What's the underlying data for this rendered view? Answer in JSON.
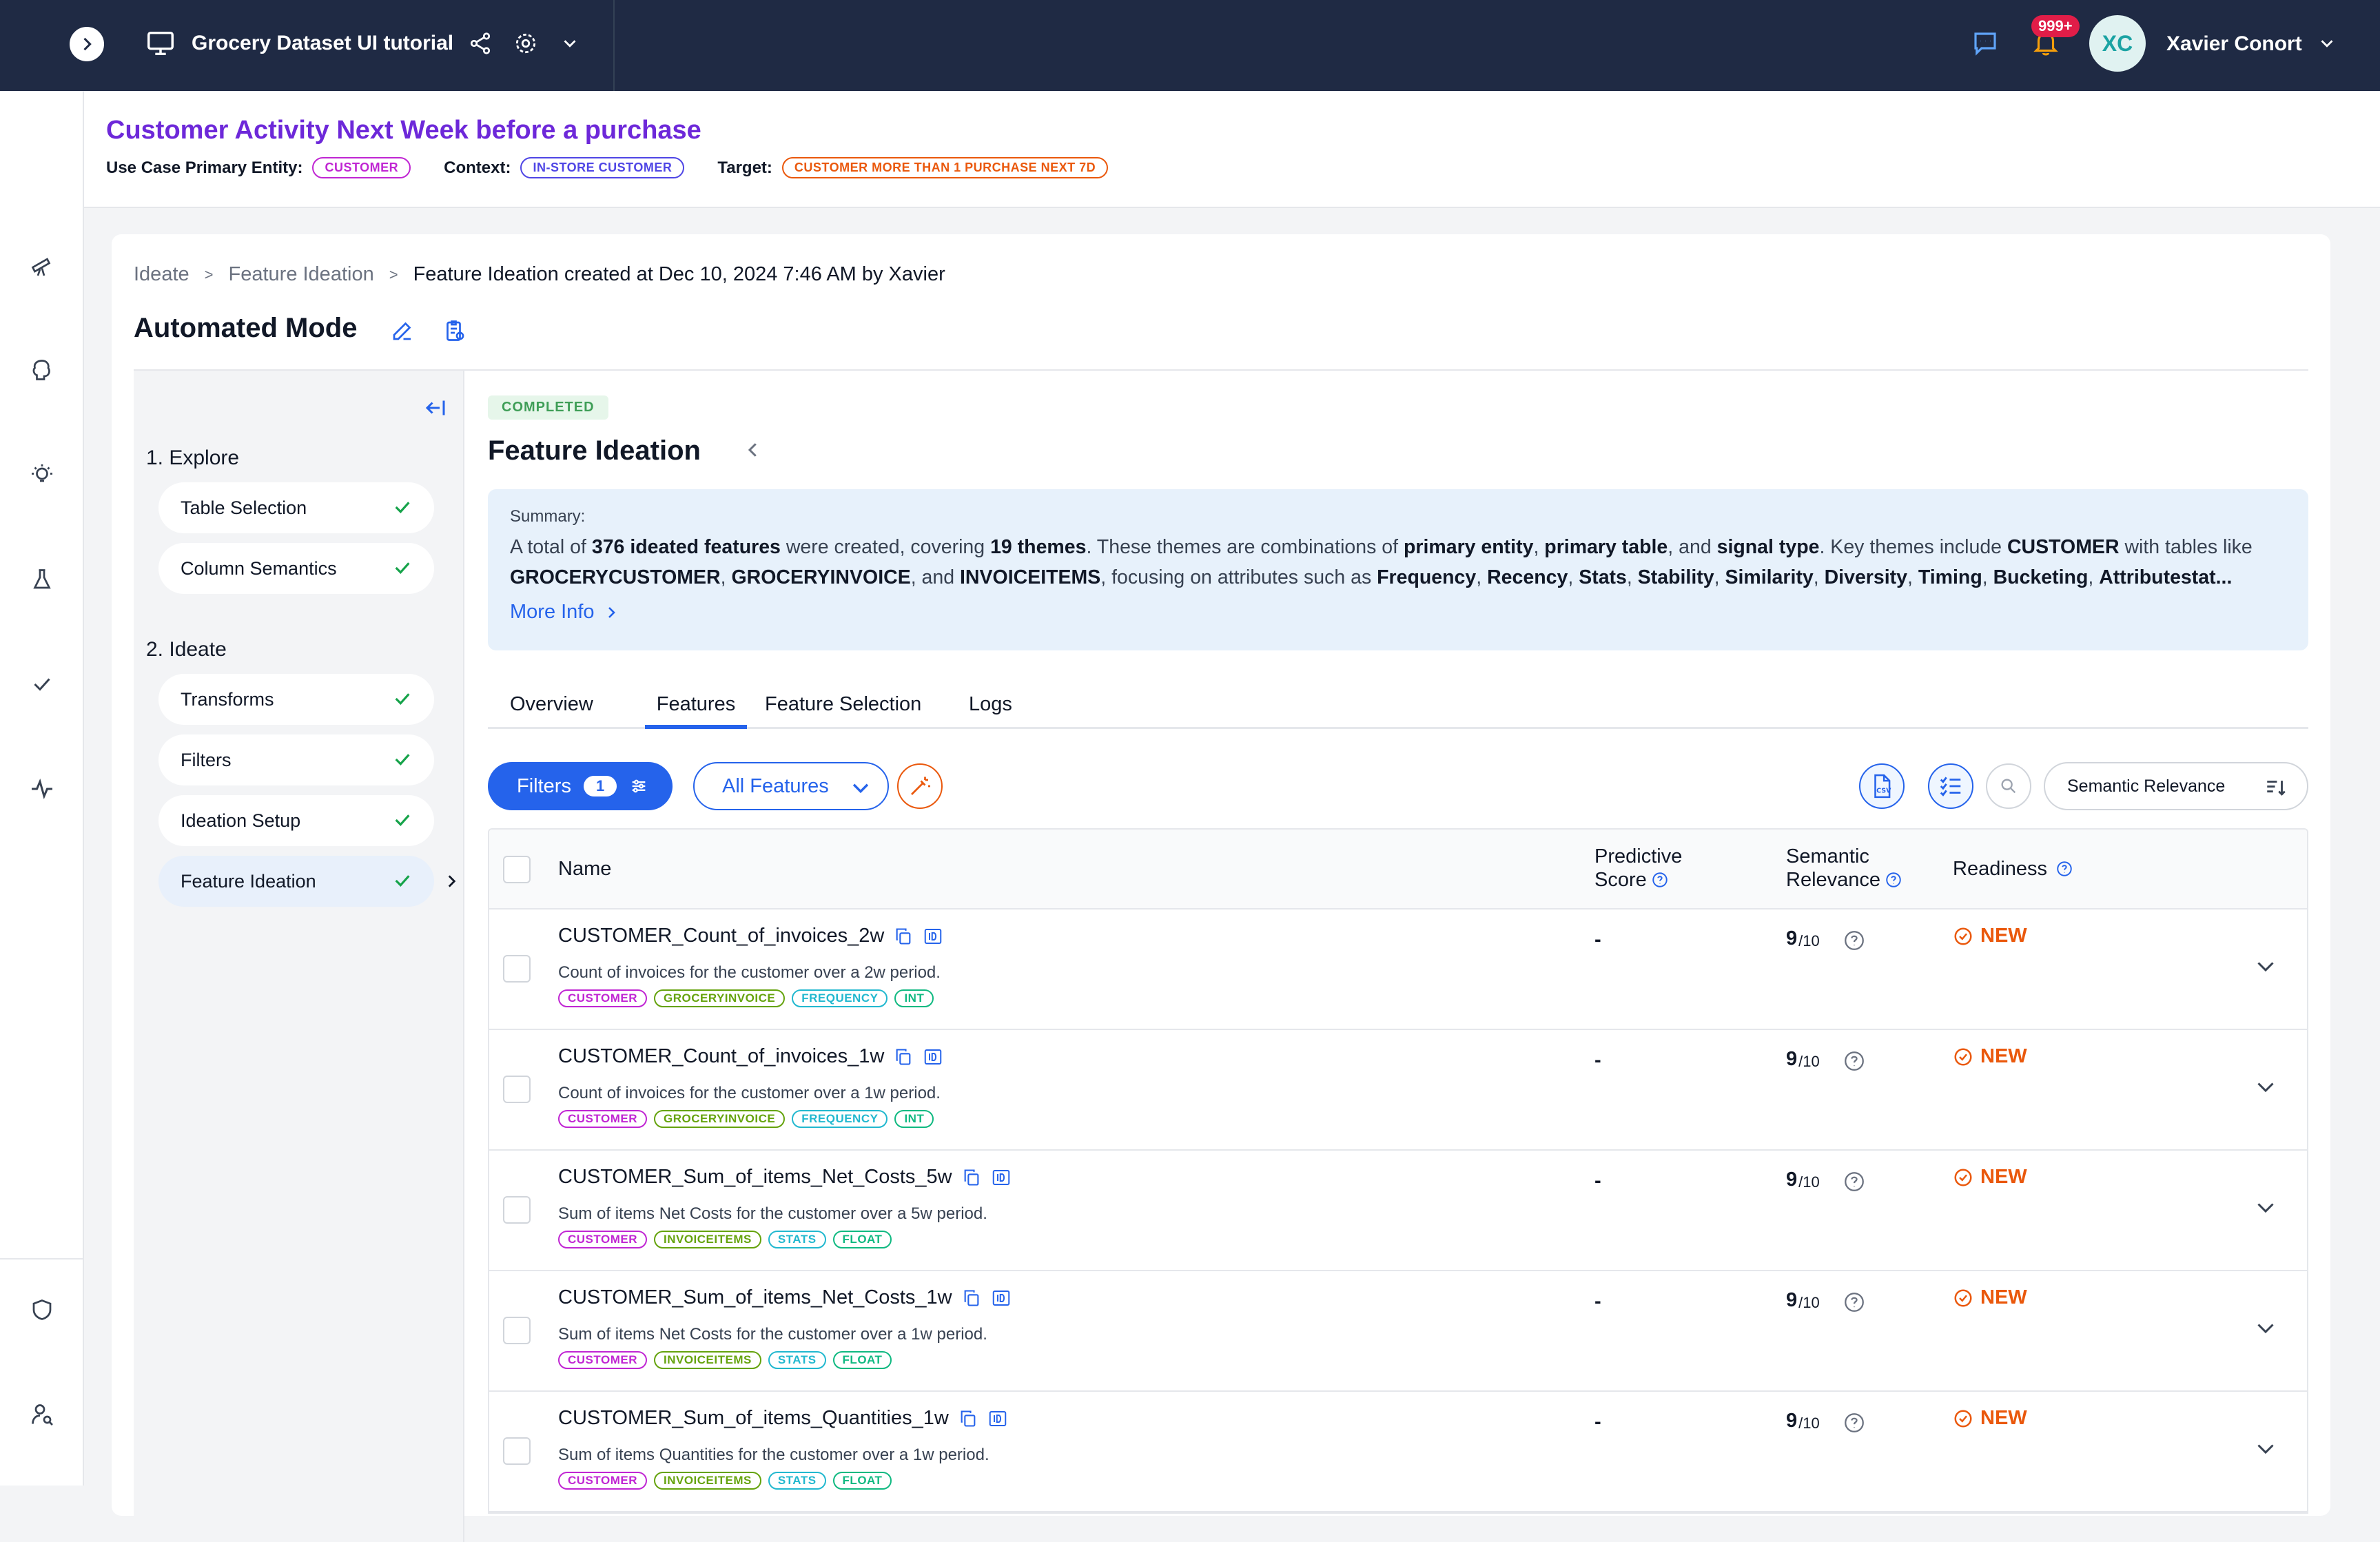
{
  "topbar": {
    "project_title": "Grocery Dataset UI tutorial",
    "notification_count": "999+",
    "avatar_initials": "XC",
    "user_name": "Xavier Conort"
  },
  "use_case": {
    "title": "Customer Activity Next Week before a purchase",
    "primary_entity_label": "Use Case Primary Entity:",
    "primary_entity_value": "CUSTOMER",
    "context_label": "Context:",
    "context_value": "IN-STORE CUSTOMER",
    "target_label": "Target:",
    "target_value": "CUSTOMER MORE THAN 1 PURCHASE NEXT 7D"
  },
  "breadcrumb": {
    "items": [
      "Ideate",
      "Feature Ideation",
      "Feature Ideation created at Dec 10, 2024 7:46 AM by Xavier"
    ]
  },
  "mode_title": "Automated Mode",
  "steps": {
    "explore_heading": "1. Explore",
    "explore_items": [
      "Table Selection",
      "Column Semantics"
    ],
    "ideate_heading": "2. Ideate",
    "ideate_items": [
      "Transforms",
      "Filters",
      "Ideation Setup",
      "Feature Ideation"
    ]
  },
  "status_badge": "COMPLETED",
  "panel_title": "Feature Ideation",
  "summary": {
    "label": "Summary:",
    "t1": "A total of ",
    "b1": "376 ideated features",
    "t2": " were created, covering ",
    "b2": "19 themes",
    "t3": ". These themes are combinations of ",
    "b3": "primary entity",
    "t4": ", ",
    "b4": "primary table",
    "t5": ", and ",
    "b5": "signal type",
    "t6": ". Key themes include ",
    "b6": "CUSTOMER",
    "t7": " with tables like ",
    "b7": "GROCERYCUSTOMER",
    "t8": ", ",
    "b8": "GROCERYINVOICE",
    "t9": ", and ",
    "b9": "INVOICEITEMS",
    "t10": ", focusing on attributes such as ",
    "b10": "Frequency",
    "t11": ", ",
    "b11": "Recency",
    "t12": ", ",
    "b12": "Stats",
    "t13": ", ",
    "b13": "Stability",
    "t14": ", ",
    "b14": "Similarity",
    "t15": ", ",
    "b15": "Diversity",
    "t16": ", ",
    "b16": "Timing",
    "t17": ", ",
    "b17": "Bucketing",
    "t18": ", ",
    "b18": "Attributestat...",
    "more_info": "More Info"
  },
  "tabs": [
    "Overview",
    "Features",
    "Feature Selection",
    "Logs"
  ],
  "toolbar": {
    "filters_label": "Filters",
    "filters_count": "1",
    "all_features_label": "All Features",
    "sort_label": "Semantic Relevance"
  },
  "table": {
    "headers": {
      "name": "Name",
      "predictive_1": "Predictive",
      "predictive_2": "Score",
      "semantic_1": "Semantic",
      "semantic_2": "Relevance",
      "readiness": "Readiness"
    },
    "rows": [
      {
        "name": "CUSTOMER_Count_of_invoices_2w",
        "desc": "Count of invoices for the customer over a 2w period.",
        "tags": [
          "CUSTOMER",
          "GROCERYINVOICE",
          "FREQUENCY",
          "INT"
        ],
        "pscore": "-",
        "srel": "9",
        "srel_den": "/10",
        "readiness": "NEW"
      },
      {
        "name": "CUSTOMER_Count_of_invoices_1w",
        "desc": "Count of invoices for the customer over a 1w period.",
        "tags": [
          "CUSTOMER",
          "GROCERYINVOICE",
          "FREQUENCY",
          "INT"
        ],
        "pscore": "-",
        "srel": "9",
        "srel_den": "/10",
        "readiness": "NEW"
      },
      {
        "name": "CUSTOMER_Sum_of_items_Net_Costs_5w",
        "desc": "Sum of items Net Costs for the customer over a 5w period.",
        "tags": [
          "CUSTOMER",
          "INVOICEITEMS",
          "STATS",
          "FLOAT"
        ],
        "pscore": "-",
        "srel": "9",
        "srel_den": "/10",
        "readiness": "NEW"
      },
      {
        "name": "CUSTOMER_Sum_of_items_Net_Costs_1w",
        "desc": "Sum of items Net Costs for the customer over a 1w period.",
        "tags": [
          "CUSTOMER",
          "INVOICEITEMS",
          "STATS",
          "FLOAT"
        ],
        "pscore": "-",
        "srel": "9",
        "srel_den": "/10",
        "readiness": "NEW"
      },
      {
        "name": "CUSTOMER_Sum_of_items_Quantities_1w",
        "desc": "Sum of items Quantities for the customer over a 1w period.",
        "tags": [
          "CUSTOMER",
          "INVOICEITEMS",
          "STATS",
          "FLOAT"
        ],
        "pscore": "-",
        "srel": "9",
        "srel_den": "/10",
        "readiness": "NEW"
      }
    ]
  },
  "colors": {
    "topbar": "#1f2a44",
    "accent": "#2563eb",
    "use_case_title": "#6d28d9",
    "entity_tag": "#c026d3",
    "context_tag": "#4f46e5",
    "target_tag": "#ea580c",
    "table_tag": "#65a30d",
    "signal_tag": "#22b8cf",
    "dtype_tag": "#10b981",
    "ready_new": "#ea580c",
    "completed_badge": "#3f9e57"
  }
}
